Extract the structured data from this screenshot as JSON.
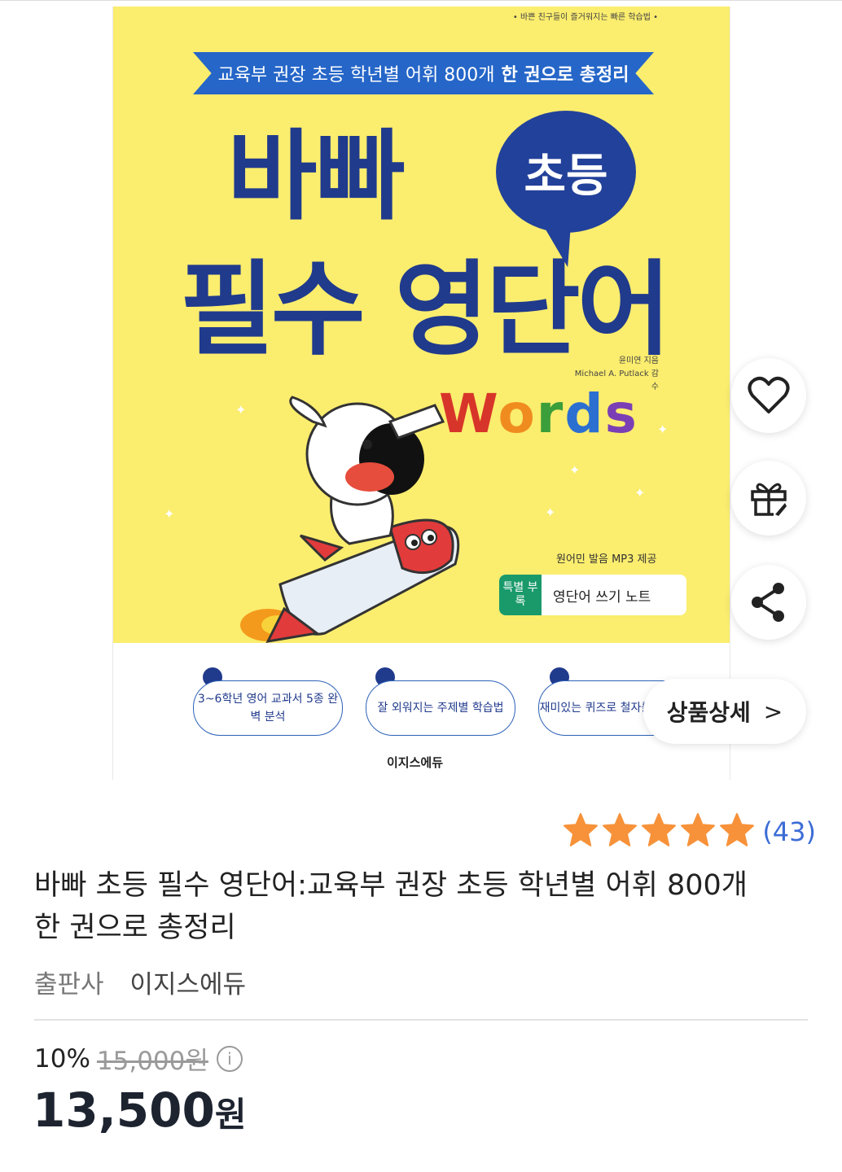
{
  "cover": {
    "tagline_small": "• 바쁜 친구들이 즐거워지는 빠른 학습법 •",
    "banner_prefix": "교육부 권장 초등 학년별 어휘 800개",
    "banner_strong": "한 권으로 총정리",
    "title_line1": "바빠",
    "bubble": "초등",
    "title_line2": "필수 영단어",
    "author": "윤미연 지음",
    "supervisor": "Michael A. Putlack 감수",
    "words_letters": [
      "W",
      "o",
      "r",
      "d",
      "s"
    ],
    "words_colors": [
      "#d8352a",
      "#f08c1f",
      "#3a9e3a",
      "#2b6fd1",
      "#7b3fb5"
    ],
    "mp3": "원어민 발음 MP3 제공",
    "appendix_badge": "특별 부록",
    "appendix_text": "영단어 쓰기 노트",
    "features": [
      "3~6학년 영어 교과서 5종 완벽 분석",
      "잘 외워지는 주제별 학습법",
      "재미있는 퀴즈로 철자를 정확히"
    ],
    "publisher_logo": "이지스에듀"
  },
  "actions": {
    "wishlist_icon": "heart-icon",
    "gift_icon": "gift-icon",
    "share_icon": "share-icon",
    "detail_label": "상품상세",
    "detail_chevron": ">"
  },
  "product": {
    "rating_stars": 5,
    "rating_count": "(43)",
    "title": "바빠 초등 필수 영단어:교육부 권장 초등 학년별 어휘 800개 한 권으로 총정리",
    "publisher_label": "출판사",
    "publisher": "이지스에듀",
    "discount": "10%",
    "original_price": "15,000원",
    "info_symbol": "i",
    "price_number": "13,500",
    "price_unit": "원"
  },
  "colors": {
    "cover_yellow": "#fbed6e",
    "cover_navy": "#203a8c",
    "banner_blue": "#2566c8",
    "star_orange": "#f7923a",
    "rating_blue": "#3c6cd6"
  }
}
